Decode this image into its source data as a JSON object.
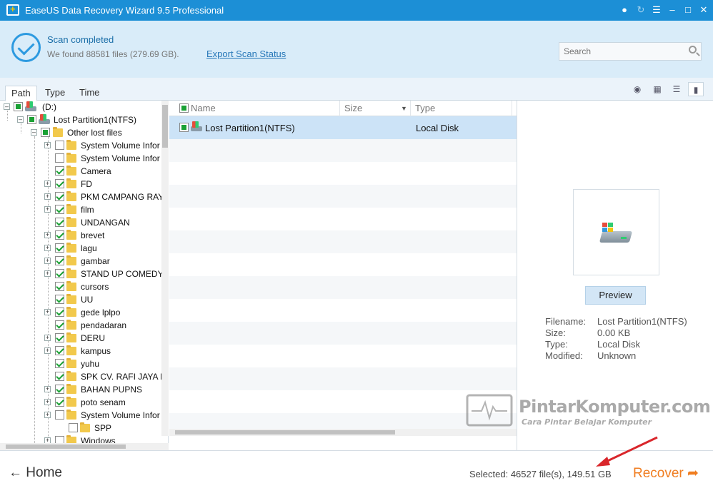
{
  "window": {
    "title": "EaseUS Data Recovery Wizard 9.5 Professional"
  },
  "header": {
    "status_title": "Scan completed",
    "status_detail": "We found 88581 files (279.69 GB).",
    "export_link": "Export Scan Status",
    "search_placeholder": "Search"
  },
  "tabs": [
    "Path",
    "Type",
    "Time"
  ],
  "active_tab": "Path",
  "tree": {
    "root": "(D:)",
    "partition": "Lost Partition1(NTFS)",
    "other_lost": "Other lost files",
    "items": [
      {
        "label": "System Volume Infor",
        "checked": false,
        "expandable": true
      },
      {
        "label": "System Volume Infor",
        "checked": false,
        "expandable": false
      },
      {
        "label": "Camera",
        "checked": true,
        "expandable": false
      },
      {
        "label": "FD",
        "checked": true,
        "expandable": true
      },
      {
        "label": "PKM CAMPANG RAY.",
        "checked": true,
        "expandable": true
      },
      {
        "label": "film",
        "checked": true,
        "expandable": true
      },
      {
        "label": "UNDANGAN",
        "checked": true,
        "expandable": false
      },
      {
        "label": "brevet",
        "checked": true,
        "expandable": true
      },
      {
        "label": "lagu",
        "checked": true,
        "expandable": true
      },
      {
        "label": "gambar",
        "checked": true,
        "expandable": true
      },
      {
        "label": "STAND UP COMEDY",
        "checked": true,
        "expandable": true
      },
      {
        "label": "cursors",
        "checked": true,
        "expandable": false
      },
      {
        "label": "UU",
        "checked": true,
        "expandable": false
      },
      {
        "label": "gede lplpo",
        "checked": true,
        "expandable": true
      },
      {
        "label": "pendadaran",
        "checked": true,
        "expandable": false
      },
      {
        "label": "DERU",
        "checked": true,
        "expandable": true
      },
      {
        "label": "kampus",
        "checked": true,
        "expandable": true
      },
      {
        "label": "yuhu",
        "checked": true,
        "expandable": false
      },
      {
        "label": "SPK CV. RAFI JAYA M.",
        "checked": true,
        "expandable": false
      },
      {
        "label": "BAHAN PUPNS",
        "checked": true,
        "expandable": true
      },
      {
        "label": "poto senam",
        "checked": true,
        "expandable": true
      },
      {
        "label": "System Volume Infor",
        "checked": false,
        "expandable": true
      },
      {
        "label": "SPP",
        "checked": false,
        "expandable": false,
        "child": true
      },
      {
        "label": "Windows",
        "checked": false,
        "expandable": true
      }
    ]
  },
  "list": {
    "columns": [
      "Name",
      "Size",
      "Type"
    ],
    "rows": [
      {
        "name": "Lost Partition1(NTFS)",
        "size": "",
        "type": "Local Disk"
      }
    ]
  },
  "preview": {
    "button": "Preview",
    "labels": [
      "Filename:",
      "Size:",
      "Type:",
      "Modified:"
    ],
    "values": [
      "Lost Partition1(NTFS)",
      "0.00 KB",
      "Local Disk",
      "Unknown"
    ]
  },
  "footer": {
    "home": "Home",
    "selected": "Selected: 46527 file(s), 149.51 GB",
    "recover": "Recover"
  },
  "watermark": {
    "brand": "PintarKomputer.com",
    "tagline": "Cara Pintar Belajar Komputer"
  },
  "colors": {
    "titlebar": "#1c8fd6",
    "header_bg": "#d9ecf9",
    "accent_orange": "#f07d20",
    "check_green": "#1aa134",
    "arrow_red": "#d9262b"
  }
}
